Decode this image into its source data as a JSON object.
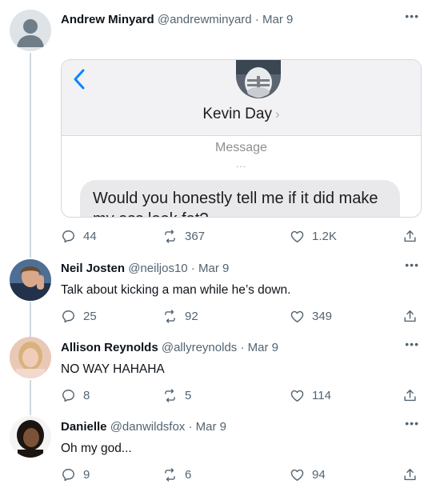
{
  "tweets": [
    {
      "name": "Andrew Minyard",
      "handle": "@andrewminyard",
      "separator": "·",
      "date": "Mar 9",
      "more": "•••",
      "embed": {
        "contact_name": "Kevin Day",
        "contact_chevron": "›",
        "message_label": "Message",
        "message_dots": "...",
        "bubble_text": "Would you honestly tell me if it did make my ass look fat?"
      },
      "replies": "44",
      "retweets": "367",
      "likes": "1.2K"
    },
    {
      "name": "Neil Josten",
      "handle": "@neiljos10",
      "separator": "·",
      "date": "Mar 9",
      "more": "•••",
      "text": "Talk about kicking a man while he’s down.",
      "replies": "25",
      "retweets": "92",
      "likes": "349"
    },
    {
      "name": "Allison Reynolds",
      "handle": "@allyreynolds",
      "separator": "·",
      "date": "Mar 9",
      "more": "•••",
      "text": "NO WAY HAHAHA",
      "replies": "8",
      "retweets": "5",
      "likes": "114"
    },
    {
      "name": "Danielle",
      "handle": "@danwildsfox",
      "separator": "·",
      "date": "Mar 9",
      "more": "•••",
      "text": "Oh my god...",
      "replies": "9",
      "retweets": "6",
      "likes": "94"
    }
  ],
  "icons": {
    "reply": "reply-icon",
    "retweet": "retweet-icon",
    "like": "heart-icon",
    "share": "share-icon",
    "back": "chevron-left-icon"
  },
  "colors": {
    "text": "#0f1419",
    "secondary": "#536471",
    "thread_line": "#cfd9de",
    "ios_blue": "#0a84ff",
    "bubble": "#e9e9eb"
  }
}
